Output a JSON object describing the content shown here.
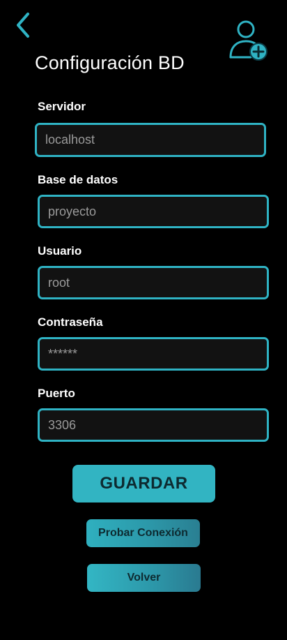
{
  "header": {
    "title": "Configuración BD",
    "back_icon": "chevron-left-icon",
    "add_user_icon": "user-plus-icon"
  },
  "form": {
    "server": {
      "label": "Servidor",
      "value": "localhost"
    },
    "database": {
      "label": "Base de datos",
      "value": "proyecto"
    },
    "user": {
      "label": "Usuario",
      "value": "root"
    },
    "password": {
      "label": "Contraseña",
      "value": "******"
    },
    "port": {
      "label": "Puerto",
      "value": "3306"
    }
  },
  "actions": {
    "save_label": "GUARDAR",
    "test_label": "Probar Conexión",
    "back_label": "Volver"
  },
  "colors": {
    "background": "#000000",
    "accent": "#2fb3c4",
    "input_bg": "#121212",
    "button_text": "#0d2a30"
  }
}
